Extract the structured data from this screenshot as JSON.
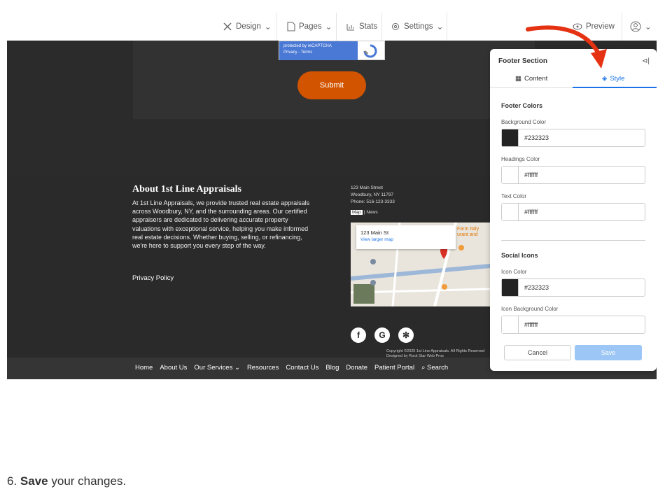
{
  "topbar": {
    "design": "Design",
    "pages": "Pages",
    "stats": "Stats",
    "settings": "Settings",
    "preview": "Preview"
  },
  "form": {
    "recaptcha_line1": "protected by reCAPTCHA",
    "recaptcha_line2": "Privacy - Terms",
    "submit_label": "Submit"
  },
  "footer": {
    "about_title": "About 1st Line Appraisals",
    "about_text": "At 1st Line Appraisals, we provide trusted real estate appraisals across Woodbury, NY, and the surrounding areas. Our certified appraisers are dedicated to delivering accurate property valuations with exceptional service, helping you make informed real estate decisions. Whether buying, selling, or refinancing, we're here to support you every step of the way.",
    "privacy": "Privacy Policy",
    "address_line1": "123 Main Street",
    "address_line2": "Woodbury, NY 11797",
    "phone": "Phone: 516-123-3333",
    "map_tab": "Map",
    "news_tab": "News",
    "map_card_title": "123 Main St",
    "map_card_link": "View larger map",
    "map_poi": "Farm Italy",
    "map_poi2": "urant and",
    "copyright_line1": "Copyright ©2025 1st Line Appraisals. All Rights Reserved",
    "copyright_line2": "Designed by Rock Star Web Pros",
    "social_icons": [
      "facebook-icon",
      "google-icon",
      "yelp-icon"
    ]
  },
  "nav": {
    "items": [
      "Home",
      "About Us",
      "Our Services",
      "Resources",
      "Contact Us",
      "Blog",
      "Donate",
      "Patient Portal",
      "Search"
    ]
  },
  "panel": {
    "title": "Footer Section",
    "tab_content": "Content",
    "tab_style": "Style",
    "section_colors": "Footer Colors",
    "bg_label": "Background Color",
    "bg_value": "#232323",
    "headings_label": "Headings Color",
    "headings_value": "#ffffff",
    "text_label": "Text Color",
    "text_value": "#ffffff",
    "section_social": "Social Icons",
    "icon_label": "Icon Color",
    "icon_value": "#232323",
    "icon_bg_label": "Icon Background Color",
    "icon_bg_value": "#ffffff",
    "cancel": "Cancel",
    "save": "Save"
  },
  "instruction": {
    "number": "6.",
    "bold": "Save",
    "rest": "your changes."
  },
  "colors": {
    "accent": "#1a73e8",
    "submit": "#d35400",
    "footer_bg": "#2a2a2a",
    "arrow": "#e53212",
    "swatch_dark": "#232323",
    "swatch_light": "#ffffff"
  }
}
